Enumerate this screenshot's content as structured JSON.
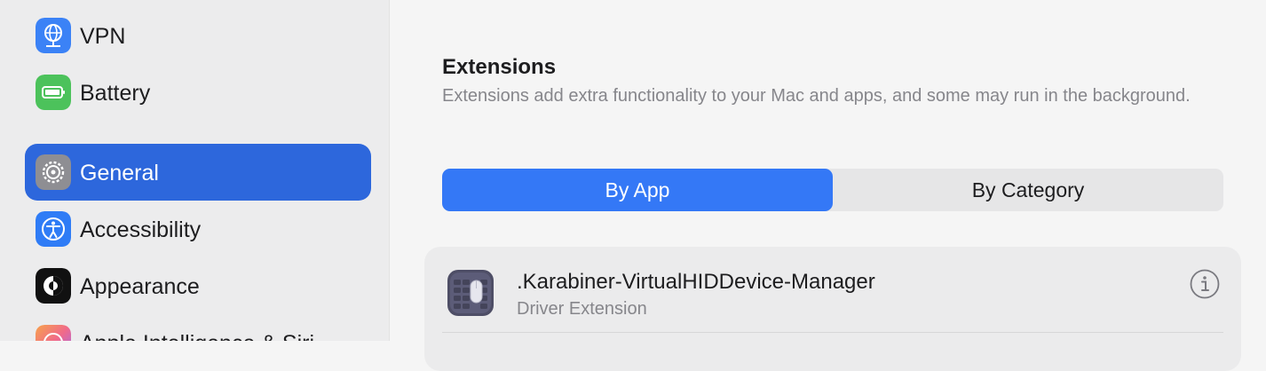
{
  "sidebar": {
    "items": [
      {
        "label": "VPN",
        "icon": "globe-network-icon",
        "color": "#3b82f6"
      },
      {
        "label": "Battery",
        "icon": "battery-icon",
        "color": "#4cc25b"
      },
      {
        "label": "General",
        "icon": "gear-icon",
        "color": "#8e8e93",
        "selected": true
      },
      {
        "label": "Accessibility",
        "icon": "accessibility-icon",
        "color": "#2f7cf6"
      },
      {
        "label": "Appearance",
        "icon": "appearance-icon",
        "color": "#111111"
      },
      {
        "label": "Apple Intelligence & Siri",
        "icon": "apple-intelligence-icon",
        "color": "#f06a8a"
      }
    ]
  },
  "main": {
    "section_title": "Extensions",
    "section_description": "Extensions add extra functionality to your Mac and apps, and some may run in the background.",
    "segments": [
      {
        "label": "By App",
        "active": true
      },
      {
        "label": "By Category",
        "active": false
      }
    ],
    "extensions": [
      {
        "name": ".Karabiner-VirtualHIDDevice-Manager",
        "type": "Driver Extension",
        "icon": "karabiner-keyboard-icon"
      }
    ]
  },
  "colors": {
    "accent": "#3478f6",
    "selection": "#2d67dc",
    "secondary_text": "#86868b"
  }
}
